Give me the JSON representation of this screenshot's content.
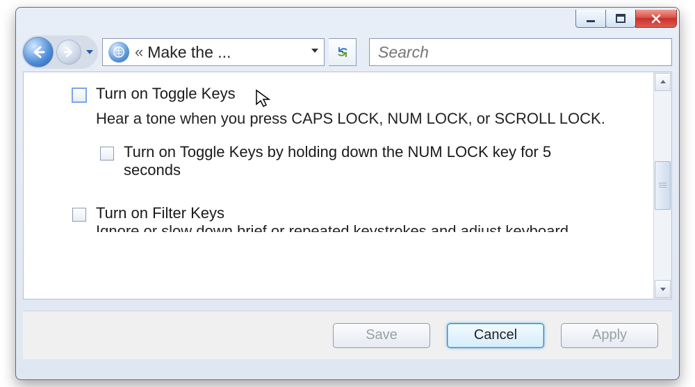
{
  "titlebar": {
    "minimize_icon": "minimize",
    "maximize_icon": "maximize",
    "close_icon": "close"
  },
  "nav": {
    "breadcrumb_prefix": "«",
    "breadcrumb_text": "Make the ...",
    "search_placeholder": "Search"
  },
  "options": {
    "toggle_keys": {
      "label": "Turn on Toggle Keys",
      "checked": false,
      "description": "Hear a tone when you press CAPS LOCK, NUM LOCK, or SCROLL LOCK.",
      "sub": {
        "label": "Turn on Toggle Keys by holding down the NUM LOCK key for 5 seconds",
        "checked": false
      }
    },
    "filter_keys": {
      "label": "Turn on Filter Keys",
      "checked": false,
      "description_cut": "Ignore or slow down brief or repeated keystrokes and adjust keyboard"
    }
  },
  "footer": {
    "save": "Save",
    "cancel": "Cancel",
    "apply": "Apply"
  }
}
